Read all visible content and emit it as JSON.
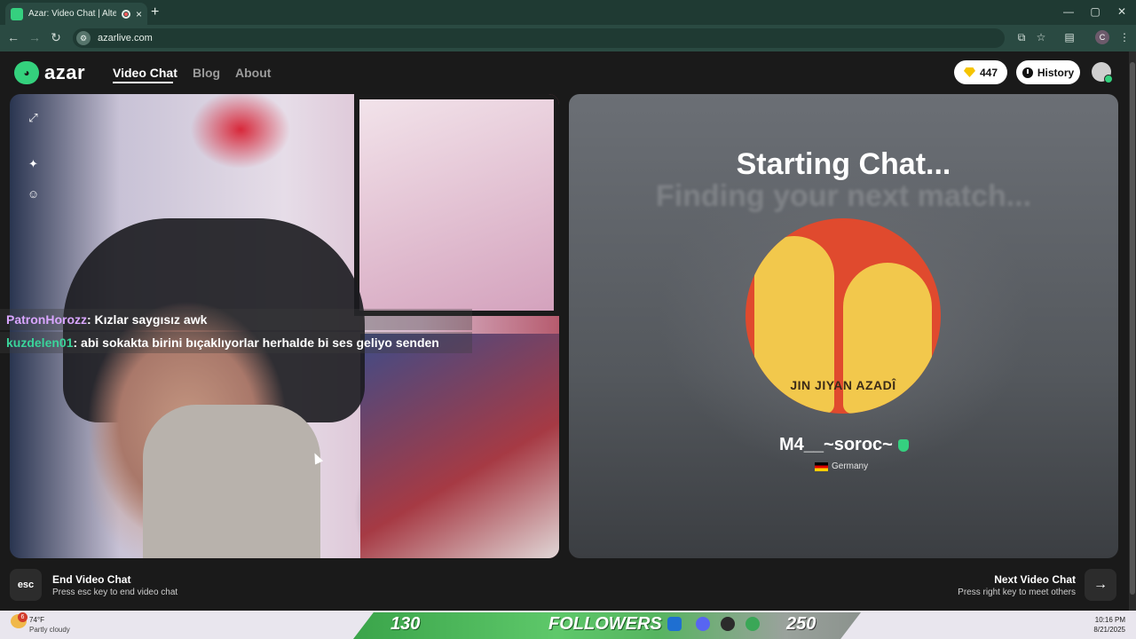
{
  "browser": {
    "tab_title": "Azar: Video Chat | Alternati",
    "tab_close": "×",
    "new_tab": "+",
    "url": "azarlive.com",
    "profile_initial": "C"
  },
  "header": {
    "logo_text": "azar",
    "nav": [
      {
        "label": "Video Chat",
        "active": true
      },
      {
        "label": "Blog"
      },
      {
        "label": "About"
      }
    ],
    "gems_count": "447",
    "history_label": "History"
  },
  "chat_overlay": [
    {
      "user": "PatronHorozz",
      "message": " : Kızlar saygısız awk"
    },
    {
      "user": "kuzdelen01",
      "message": " : abi sokakta birini bıçaklıyorlar herhalde bi ses geliyo senden"
    }
  ],
  "match": {
    "status_title": "Starting Chat...",
    "status_subtitle": "Finding your next match...",
    "photo_text": "JIN JIYAN AZADÎ",
    "name": "M4__~soroc~",
    "country": "Germany"
  },
  "controls": {
    "end_key": "esc",
    "end_title": "End Video Chat",
    "end_subtitle": "Press esc key to end video chat",
    "next_title": "Next Video Chat",
    "next_subtitle": "Press right key to meet others",
    "next_arrow": "→"
  },
  "taskbar": {
    "weather_badge": "6",
    "weather_temp": "74°F",
    "weather_desc": "Partly cloudy",
    "followers_current": "130",
    "followers_label": "FOLLOWERS",
    "followers_goal": "250",
    "time": "10:16 PM",
    "date": "8/21/2025"
  },
  "colors": {
    "brand_green": "#34d17d",
    "chat_user1": "#d9a6ff",
    "chat_user2": "#3ad49a"
  },
  "icons": {
    "expand": "expand-icon",
    "effects": "sparkle-icon",
    "sticker": "sticker-icon"
  }
}
